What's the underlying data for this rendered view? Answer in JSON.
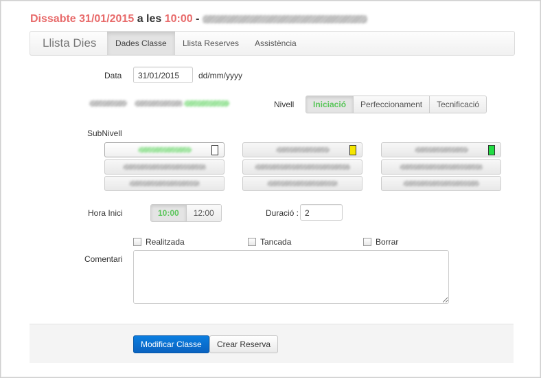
{
  "header": {
    "day": "Dissabte",
    "date": "31/01/2015",
    "connector": "a les",
    "time": "10:00",
    "dash": "-"
  },
  "nav": {
    "brand": "Llista Dies",
    "tabs": [
      {
        "label": "Dades Classe",
        "active": true
      },
      {
        "label": "Llista Reserves",
        "active": false
      },
      {
        "label": "Assistència",
        "active": false
      }
    ]
  },
  "form": {
    "date_label": "Data",
    "date_value": "31/01/2015",
    "date_format": "dd/mm/yyyy",
    "level_label": "Nivell",
    "levels": [
      {
        "label": "Iniciació",
        "selected": true
      },
      {
        "label": "Perfeccionament",
        "selected": false
      },
      {
        "label": "Tecnificació",
        "selected": false
      }
    ],
    "sublevel_label": "SubNivell",
    "sublevel_colors": {
      "col1": "#ffffff",
      "col2": "#f5e600",
      "col3": "#22dd44"
    },
    "start_label": "Hora Inici",
    "start_options": [
      {
        "label": "10:00",
        "selected": true
      },
      {
        "label": "12:00",
        "selected": false
      }
    ],
    "duration_label": "Duració :",
    "duration_value": "2",
    "checkboxes": {
      "done": "Realitzada",
      "closed": "Tancada",
      "delete": "Borrar"
    },
    "comment_label": "Comentari",
    "comment_value": ""
  },
  "footer": {
    "modify_label": "Modificar Classe",
    "reserve_label": "Crear Reserva"
  }
}
